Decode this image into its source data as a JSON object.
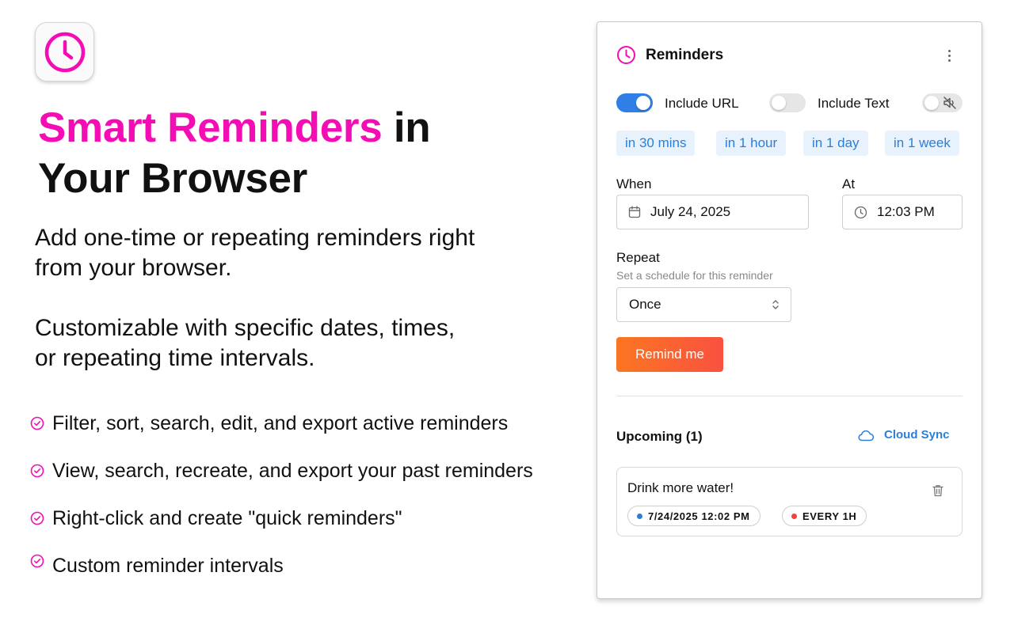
{
  "colors": {
    "accent_pink": "#f40db4",
    "toggle_blue": "#2f7fe6",
    "chip_bg": "#e8f2fd",
    "chip_text": "#2b7fd9",
    "button_gradient_start": "#fb7622",
    "button_gradient_end": "#f9513f"
  },
  "promo": {
    "app_icon": "clock-icon",
    "headline_accent": "Smart Reminders",
    "headline_rest_line1": " in",
    "headline_line2": "Your Browser",
    "paragraph1_line1": "Add one-time or repeating reminders right",
    "paragraph1_line2": "from your browser.",
    "paragraph2_line1": "Customizable with specific dates, times,",
    "paragraph2_line2": "or repeating time intervals.",
    "features": [
      "Filter, sort, search, edit, and export active reminders",
      "View, search, recreate, and export your past reminders",
      "Right-click and create \"quick reminders\"",
      "Custom reminder intervals"
    ]
  },
  "popup": {
    "title": "Reminders",
    "header_icon": "clock-icon",
    "menu_icon": "more-vertical-icon",
    "toggles": {
      "include_url": {
        "label": "Include URL",
        "on": true
      },
      "include_text": {
        "label": "Include Text",
        "on": false
      },
      "sound": {
        "icon": "volume-off-icon",
        "on": false
      }
    },
    "quick_chips": [
      "in 30 mins",
      "in 1 hour",
      "in 1 day",
      "in 1 week"
    ],
    "when": {
      "label": "When",
      "value": "July 24, 2025",
      "icon": "calendar-icon"
    },
    "at": {
      "label": "At",
      "value": "12:03 PM",
      "icon": "clock-icon"
    },
    "repeat": {
      "label": "Repeat",
      "hint": "Set a schedule for this reminder",
      "value": "Once",
      "icon": "chevron-up-down-icon"
    },
    "submit_label": "Remind me",
    "upcoming": {
      "heading": "Upcoming (1)",
      "cloud_sync_label": "Cloud Sync",
      "cloud_icon": "cloud-icon",
      "items": [
        {
          "title": "Drink more water!",
          "date_badge": "7/24/2025 12:02 PM",
          "date_dot_color": "#2b7fd9",
          "repeat_badge": "EVERY 1H",
          "repeat_dot_color": "#f0453a",
          "delete_icon": "trash-icon"
        }
      ]
    }
  }
}
